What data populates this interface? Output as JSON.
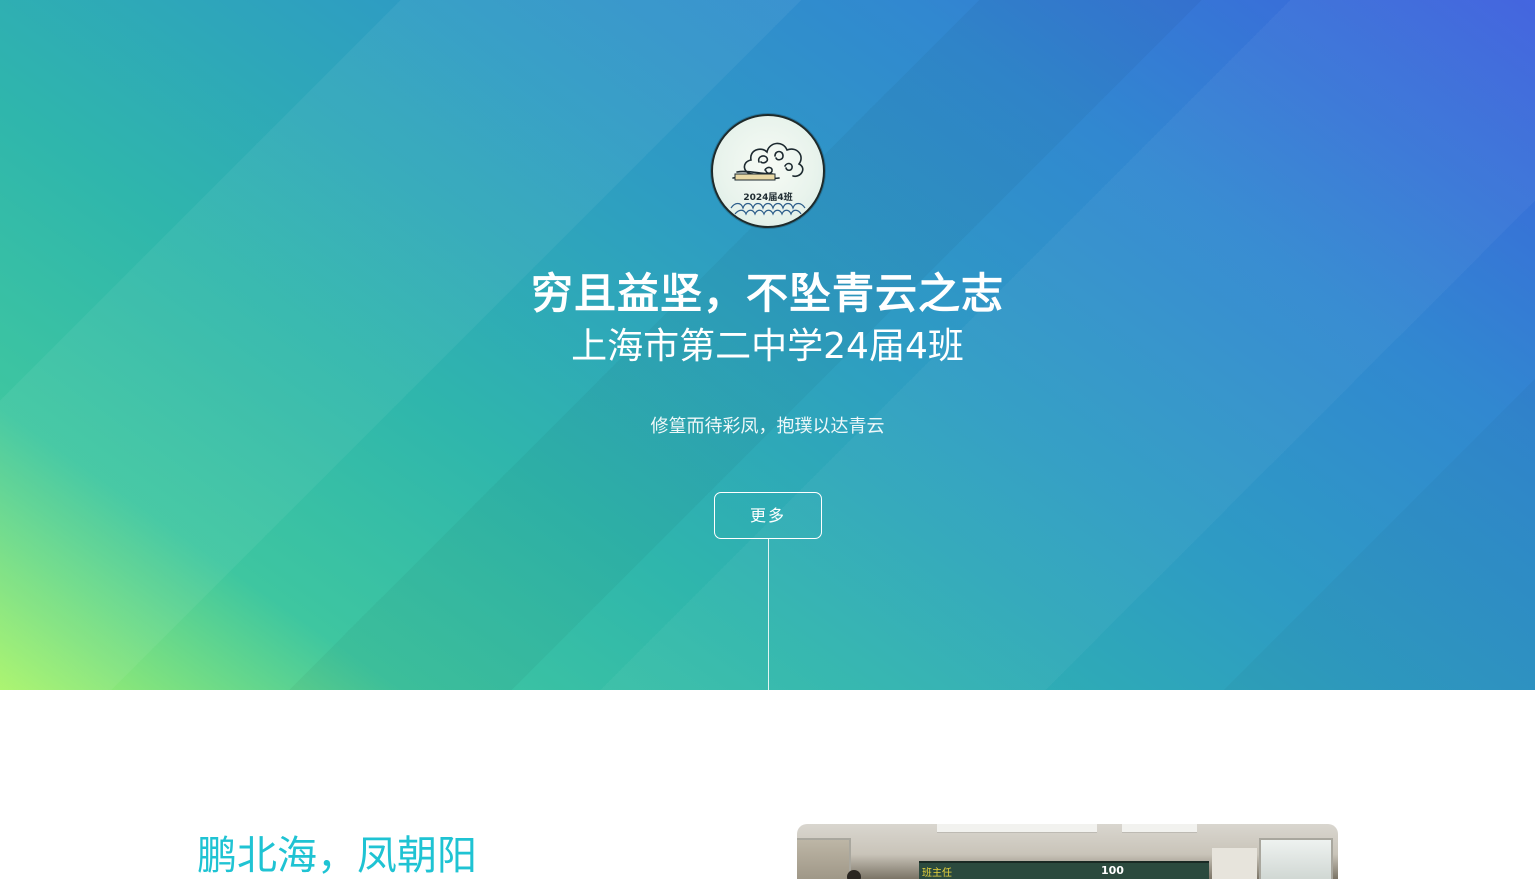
{
  "hero": {
    "logo": {
      "badge_text": "2024届4班",
      "icon": "auspicious-cloud-icon"
    },
    "title": "穷且益坚，不坠青云之志",
    "subtitle": "上海市第二中学24届4班",
    "motto": "修篁而待彩凤，抱璞以达青云",
    "more_button": "更多",
    "colors": {
      "gradient_start": "#a8f46a",
      "gradient_mid": "#2fb6ac",
      "gradient_end": "#3d5fde"
    }
  },
  "section": {
    "heading": "鹏北海，凤朝阳",
    "heading_color": "#1fc3d3",
    "photo": {
      "board_text": "班主任",
      "board_number": "100"
    }
  }
}
